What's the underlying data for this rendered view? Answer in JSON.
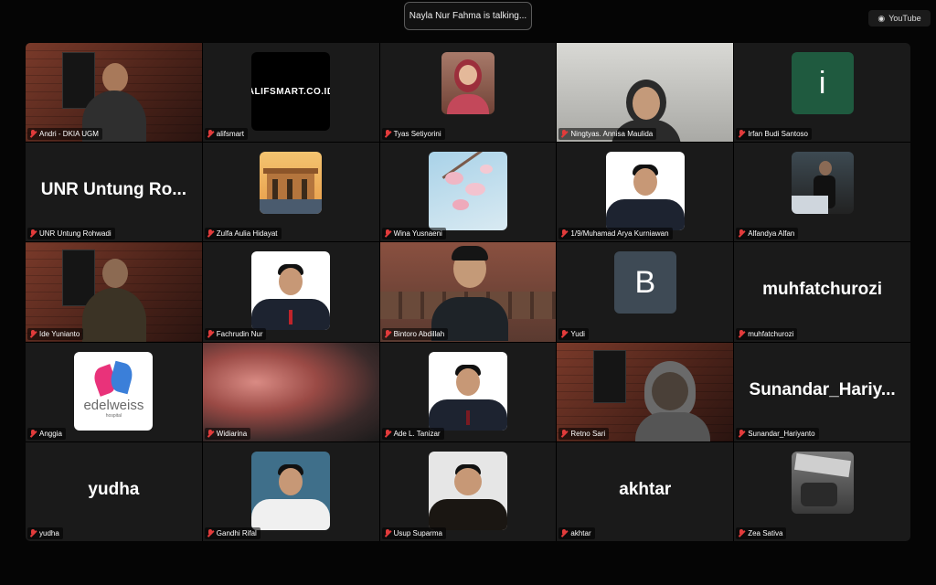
{
  "banner": {
    "talking": "Nayla Nur Fahma is talking..."
  },
  "youtube": {
    "label": "YouTube",
    "icon": "broadcast-icon"
  },
  "tiles": [
    {
      "name": "Andri - DKIA UGM",
      "kind": "video"
    },
    {
      "name": "alifsmart",
      "kind": "logo",
      "logo_text": "ALIFSMART.CO.ID"
    },
    {
      "name": "Tyas Setiyorini",
      "kind": "photo"
    },
    {
      "name": "Ningtyas. Annisa Maulida",
      "kind": "video"
    },
    {
      "name": "Irfan Budi Santoso",
      "kind": "letter",
      "letter": "i",
      "color": "#1f5a3f"
    },
    {
      "name": "UNR Untung Rohwadi",
      "kind": "text",
      "display": "UNR Untung Ro..."
    },
    {
      "name": "Zulfa Aulia Hidayat",
      "kind": "photo"
    },
    {
      "name": "Wina Yusnaeni",
      "kind": "photo"
    },
    {
      "name": "1/9/Muhamad Arya Kurniawan",
      "kind": "photo"
    },
    {
      "name": "Alfandya Alfan",
      "kind": "photo"
    },
    {
      "name": "Ide Yunianto",
      "kind": "video"
    },
    {
      "name": "Fachrudin Nur",
      "kind": "photo"
    },
    {
      "name": "Bintoro Abdillah",
      "kind": "video"
    },
    {
      "name": "Yudi",
      "kind": "letter",
      "letter": "B",
      "color": "#3e4a55"
    },
    {
      "name": "muhfatchurozi",
      "kind": "text",
      "display": "muhfatchurozi"
    },
    {
      "name": "Anggia",
      "kind": "logo",
      "logo_text": "edelweiss",
      "logo_sub": "hospital"
    },
    {
      "name": "Widiarina",
      "kind": "video"
    },
    {
      "name": "Ade L. Tanizar",
      "kind": "photo"
    },
    {
      "name": "Retno Sari",
      "kind": "video"
    },
    {
      "name": "Sunandar_Hariyanto",
      "kind": "text",
      "display": "Sunandar_Hariy..."
    },
    {
      "name": "yudha",
      "kind": "text",
      "display": "yudha"
    },
    {
      "name": "Gandhi Rifal",
      "kind": "photo"
    },
    {
      "name": "Usup Suparma",
      "kind": "photo"
    },
    {
      "name": "akhtar",
      "kind": "text",
      "display": "akhtar"
    },
    {
      "name": "Zea Sativa",
      "kind": "photo"
    }
  ]
}
